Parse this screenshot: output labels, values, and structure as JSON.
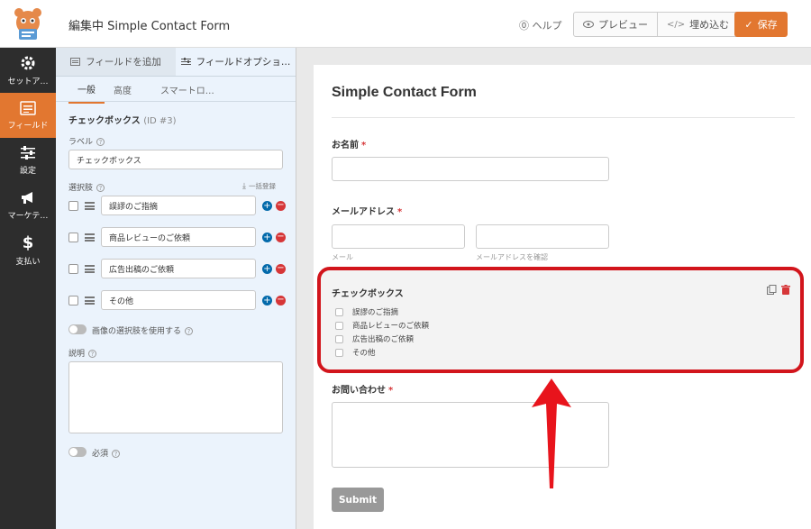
{
  "header": {
    "title": "編集中 Simple Contact Form",
    "help_label": "ヘルプ",
    "preview_label": "プレビュー",
    "embed_label": "埋め込む",
    "save_label": "保存"
  },
  "nav": {
    "items": [
      {
        "label": "セットア…",
        "icon": "gear-icon"
      },
      {
        "label": "フィールド",
        "icon": "fields-icon",
        "active": true
      },
      {
        "label": "設定",
        "icon": "sliders-icon"
      },
      {
        "label": "マーケテ…",
        "icon": "megaphone-icon"
      },
      {
        "label": "支払い",
        "icon": "dollar-icon"
      }
    ]
  },
  "panel": {
    "tabs": [
      "フィールドを追加",
      "フィールドオプショ…"
    ],
    "subtabs": [
      "一般",
      "高度",
      "スマートロ…"
    ],
    "field_title": "チェックボックス",
    "field_id": "(ID #3)",
    "label_heading": "ラベル",
    "label_value": "チェックボックス",
    "choices_heading": "選択肢",
    "bulk_add": "一括登録",
    "choices": [
      "誤謬のご指摘",
      "商品レビューのご依頼",
      "広告出稿のご依頼",
      "その他"
    ],
    "image_choices_label": "画像の選択肢を使用する",
    "description_heading": "説明",
    "required_label": "必須"
  },
  "form": {
    "title": "Simple Contact Form",
    "name_label": "お名前",
    "email_label": "メールアドレス",
    "email_sub": "メール",
    "email_confirm_sub": "メールアドレスを確認",
    "checkbox_label": "チェックボックス",
    "options": [
      "誤謬のご指摘",
      "商品レビューのご依頼",
      "広告出稿のご依頼",
      "その他"
    ],
    "message_label": "お問い合わせ",
    "required_mark": "*",
    "submit_label": "Submit"
  },
  "colors": {
    "accent": "#e27730",
    "highlight": "#d2151c",
    "nav_bg": "#2d2d2d"
  }
}
